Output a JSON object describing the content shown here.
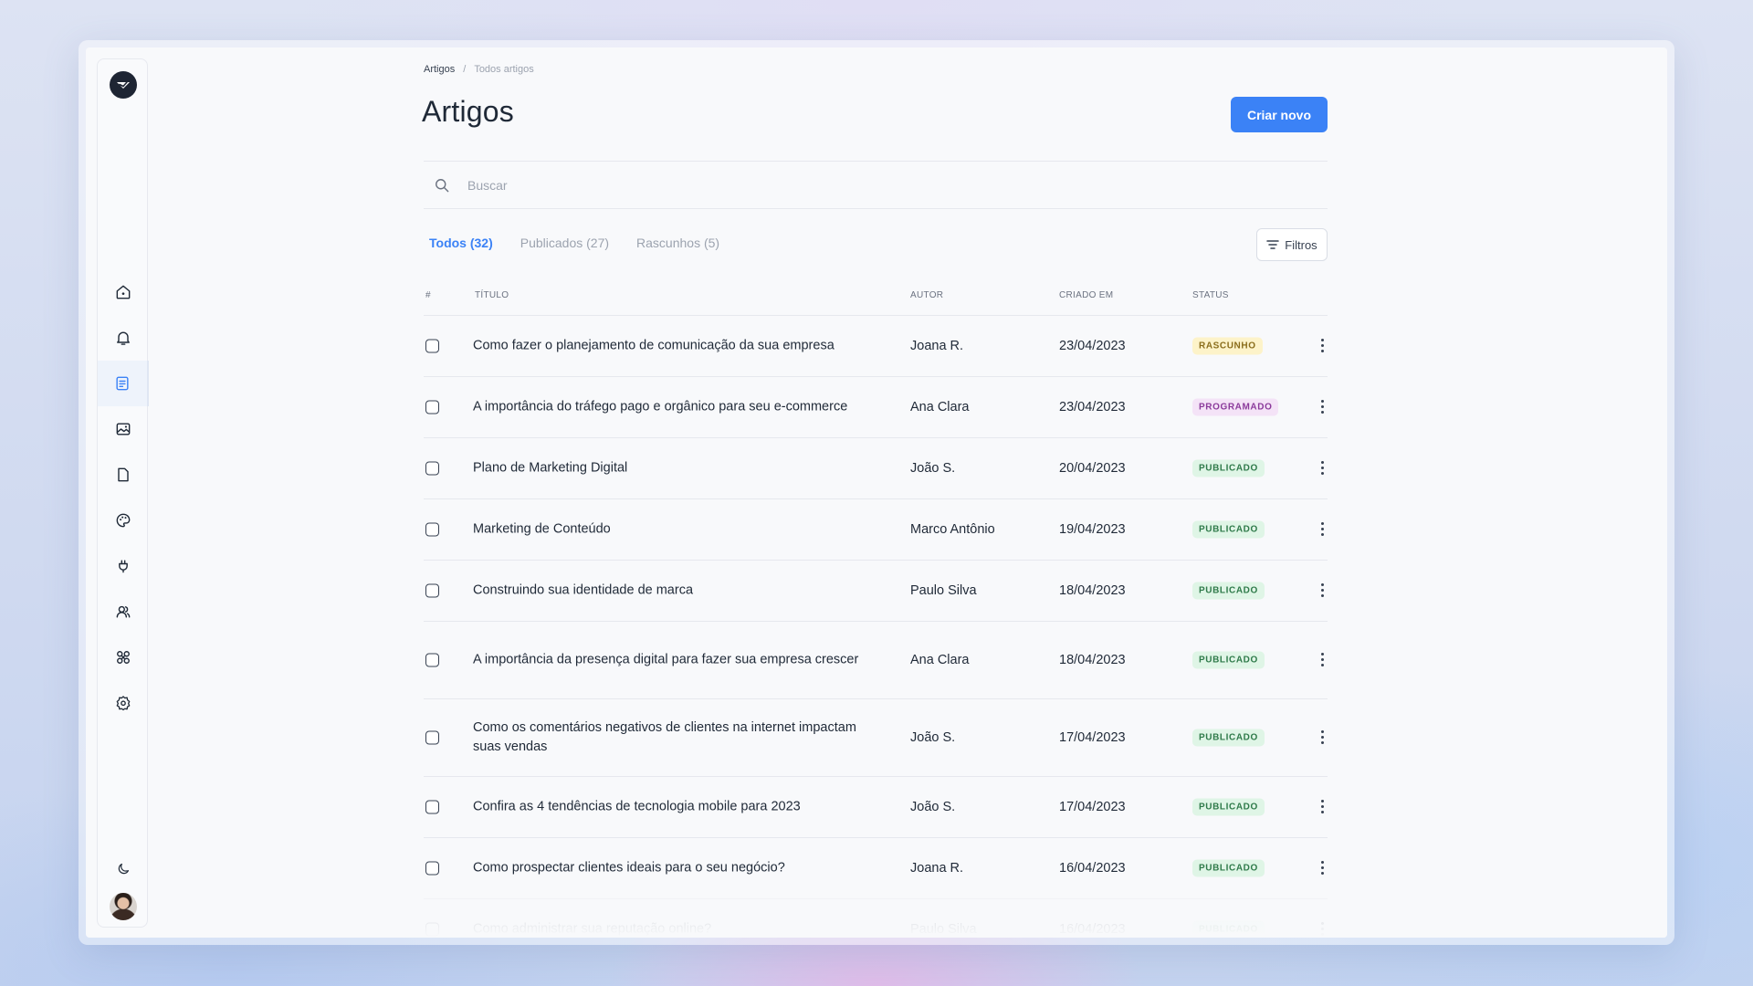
{
  "breadcrumb": {
    "root": "Artigos",
    "separator": "/",
    "current": "Todos artigos"
  },
  "page": {
    "title": "Artigos",
    "create_label": "Criar novo"
  },
  "search": {
    "placeholder": "Buscar"
  },
  "tabs": [
    {
      "label": "Todos (32)",
      "active": true
    },
    {
      "label": "Publicados (27)",
      "active": false
    },
    {
      "label": "Rascunhos (5)",
      "active": false
    }
  ],
  "filter": {
    "label": "Filtros"
  },
  "table": {
    "headers": {
      "index": "#",
      "title": "TÍTULO",
      "author": "AUTOR",
      "created": "CRIADO EM",
      "status": "STATUS"
    },
    "rows": [
      {
        "title": "Como fazer o planejamento de comunicação da sua empresa",
        "author": "Joana R.",
        "date": "23/04/2023",
        "status": "RASCUNHO",
        "status_type": "draft"
      },
      {
        "title": "A importância do tráfego pago e orgânico para seu e-commerce",
        "author": "Ana Clara",
        "date": "23/04/2023",
        "status": "PROGRAMADO",
        "status_type": "sched"
      },
      {
        "title": "Plano de Marketing Digital",
        "author": "João S.",
        "date": "20/04/2023",
        "status": "PUBLICADO",
        "status_type": "pub"
      },
      {
        "title": "Marketing de Conteúdo",
        "author": "Marco Antônio",
        "date": "19/04/2023",
        "status": "PUBLICADO",
        "status_type": "pub"
      },
      {
        "title": "Construindo sua identidade de marca",
        "author": "Paulo Silva",
        "date": "18/04/2023",
        "status": "PUBLICADO",
        "status_type": "pub"
      },
      {
        "title": "A importância da presença digital para fazer sua empresa crescer",
        "author": "Ana Clara",
        "date": "18/04/2023",
        "status": "PUBLICADO",
        "status_type": "pub"
      },
      {
        "title": "Como os comentários negativos de clientes na internet impactam suas vendas",
        "author": "João S.",
        "date": "17/04/2023",
        "status": "PUBLICADO",
        "status_type": "pub"
      },
      {
        "title": "Confira as 4 tendências de tecnologia mobile para 2023",
        "author": "João S.",
        "date": "17/04/2023",
        "status": "PUBLICADO",
        "status_type": "pub"
      },
      {
        "title": "Como prospectar clientes ideais para o seu negócio?",
        "author": "Joana R.",
        "date": "16/04/2023",
        "status": "PUBLICADO",
        "status_type": "pub"
      },
      {
        "title": "Como administrar sua reputação online?",
        "author": "Paulo Silva",
        "date": "16/04/2023",
        "status": "PUBLICADO",
        "status_type": "pub"
      }
    ]
  },
  "sidebar": {
    "icons": [
      "home-icon",
      "bell-icon",
      "articles-icon",
      "media-icon",
      "page-icon",
      "palette-icon",
      "plugin-icon",
      "users-icon",
      "tools-icon",
      "settings-icon",
      "moon-icon"
    ],
    "active": "articles-icon"
  },
  "colors": {
    "accent": "#3b82f6",
    "draft_bg": "#fdf3c9",
    "scheduled_bg": "#f4e3f7",
    "published_bg": "#dff5e6"
  }
}
